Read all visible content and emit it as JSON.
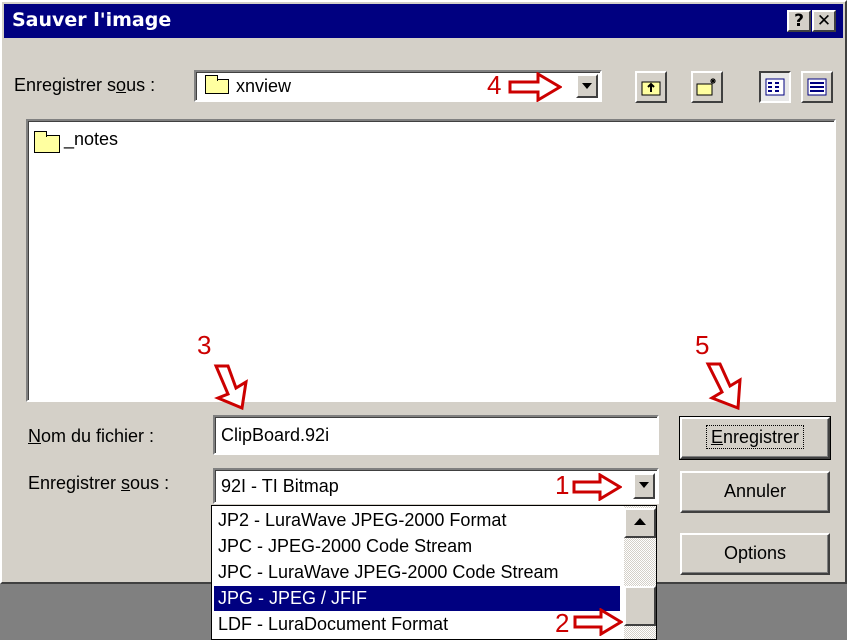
{
  "window": {
    "title": "Sauver l'image",
    "help_glyph": "?",
    "close_glyph": "✕"
  },
  "save_in": {
    "label_prefix": "Enregistrer s",
    "label_underlined": "o",
    "label_suffix": "us :",
    "value": "xnview"
  },
  "toolbar": {
    "up_icon": "folder-up-icon",
    "new_folder_icon": "new-folder-icon",
    "list_view_icon": "list-view-icon",
    "details_view_icon": "details-view-icon"
  },
  "file_list": {
    "items": [
      {
        "name": "_notes",
        "icon": "folder-icon"
      }
    ]
  },
  "filename": {
    "label_underlined": "N",
    "label_rest": "om du fichier :",
    "value": "ClipBoard.92i"
  },
  "save_as_type": {
    "label_prefix": "Enregistrer ",
    "label_underlined": "s",
    "label_suffix": "ous :",
    "value": "92I - TI Bitmap"
  },
  "type_options": [
    "JP2 - LuraWave JPEG-2000 Format",
    "JPC - JPEG-2000 Code Stream",
    "JPC - LuraWave JPEG-2000 Code Stream",
    "JPG - JPEG / JFIF",
    "LDF - LuraDocument Format"
  ],
  "selected_type_index": 3,
  "buttons": {
    "save_underlined": "E",
    "save_rest": "nregistrer",
    "cancel": "Annuler",
    "options": "Options"
  },
  "annotations": [
    "1",
    "2",
    "3",
    "4",
    "5"
  ],
  "colors": {
    "titlebar": "#000080",
    "face": "#d4d0c8",
    "annotation": "#cc0000",
    "selection": "#000080"
  }
}
